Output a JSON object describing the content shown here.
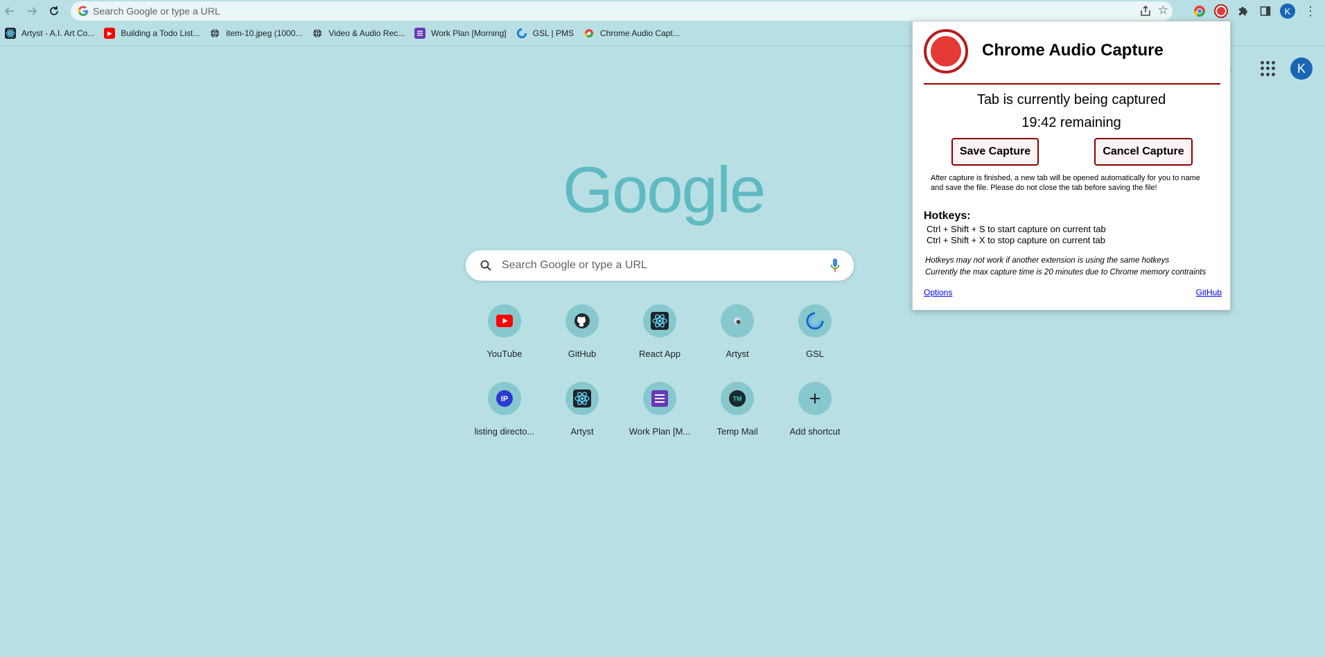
{
  "omnibox": {
    "placeholder": "Search Google or type a URL"
  },
  "profile": {
    "initial": "K"
  },
  "bookmarks": [
    {
      "label": "Artyst - A.I. Art Co...",
      "icon": "react-icon"
    },
    {
      "label": "Building a Todo List...",
      "icon": "youtube-icon"
    },
    {
      "label": "item-10.jpeg (1000...",
      "icon": "globe-icon"
    },
    {
      "label": "Video & Audio Rec...",
      "icon": "globe-icon"
    },
    {
      "label": "Work Plan [Morning]",
      "icon": "forms-icon"
    },
    {
      "label": "GSL | PMS",
      "icon": "gsl-icon"
    },
    {
      "label": "Chrome Audio Capt...",
      "icon": "chrome-icon"
    }
  ],
  "ntp": {
    "partial_label": "ges",
    "logo": "Google",
    "search_placeholder": "Search Google or type a URL",
    "shortcuts": [
      {
        "label": "YouTube",
        "icon": "youtube-icon"
      },
      {
        "label": "GitHub",
        "icon": "github-icon"
      },
      {
        "label": "React App",
        "icon": "react-icon"
      },
      {
        "label": "Artyst",
        "icon": "artyst-icon"
      },
      {
        "label": "GSL",
        "icon": "gsl-icon"
      },
      {
        "label": "listing directo...",
        "icon": "ip-icon"
      },
      {
        "label": "Artyst",
        "icon": "react-icon"
      },
      {
        "label": "Work Plan [M...",
        "icon": "forms-icon"
      },
      {
        "label": "Temp Mail",
        "icon": "tempmail-icon"
      },
      {
        "label": "Add shortcut",
        "icon": "plus-icon"
      }
    ]
  },
  "popup": {
    "title": "Chrome Audio Capture",
    "status": "Tab is currently being captured",
    "remaining": "19:42 remaining",
    "save_label": "Save Capture",
    "cancel_label": "Cancel Capture",
    "info": "After capture is finished, a new tab will be opened automatically for you to name and save the file. Please do not close the tab before saving the file!",
    "hotkeys_title": "Hotkeys:",
    "hotkey_start": "Ctrl + Shift + S to start capture on current tab",
    "hotkey_stop": "Ctrl + Shift + X to stop capture on current tab",
    "note1": "Hotkeys may not work if another extension is using the same hotkeys",
    "note2": "Currently the max capture time is 20 minutes due to Chrome memory contraints",
    "options_link": "Options",
    "github_link": "GitHub",
    "accent_color": "#9b0000"
  }
}
